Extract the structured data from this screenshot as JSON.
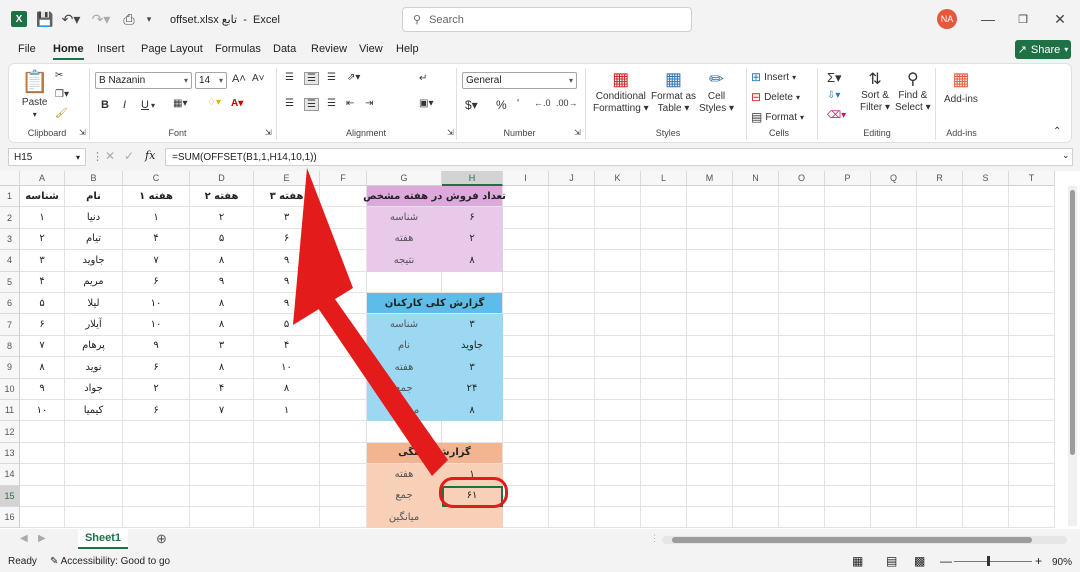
{
  "titlebar": {
    "filename": "offset.xlsx تابع",
    "app": "Excel",
    "search_placeholder": "Search",
    "avatar": "NA"
  },
  "menu": {
    "tabs": [
      "File",
      "Home",
      "Insert",
      "Page Layout",
      "Formulas",
      "Data",
      "Review",
      "View",
      "Help"
    ],
    "active": "Home",
    "share": "Share"
  },
  "ribbon": {
    "clipboard": {
      "paste": "Paste",
      "label": "Clipboard"
    },
    "font": {
      "name": "B Nazanin",
      "size": "14",
      "bold": "B",
      "italic": "I",
      "underline": "U",
      "label": "Font"
    },
    "alignment": {
      "label": "Alignment"
    },
    "number": {
      "format": "General",
      "label": "Number"
    },
    "styles": {
      "conditional": "Conditional",
      "formatting": "Formatting",
      "format_as": "Format as",
      "table": "Table",
      "cell": "Cell",
      "cell_styles": "Styles",
      "label": "Styles"
    },
    "cells": {
      "insert": "Insert",
      "delete": "Delete",
      "format": "Format",
      "label": "Cells"
    },
    "editing": {
      "sort": "Sort &",
      "filter": "Filter",
      "find": "Find &",
      "select": "Select",
      "label": "Editing"
    },
    "addins": {
      "name": "Add-ins",
      "label": "Add-ins"
    }
  },
  "formula_bar": {
    "cell": "H15",
    "fx": "fx",
    "formula": "=SUM(OFFSET(B1,1,H14,10,1))"
  },
  "grid": {
    "columns": [
      "A",
      "B",
      "C",
      "D",
      "E",
      "F",
      "G",
      "H",
      "I",
      "J",
      "K",
      "L",
      "M",
      "N",
      "O",
      "P",
      "Q",
      "R",
      "S",
      "T"
    ],
    "selected_col": "H",
    "rows": [
      "1",
      "2",
      "3",
      "4",
      "5",
      "6",
      "7",
      "8",
      "9",
      "10",
      "11",
      "12",
      "13",
      "14",
      "15",
      "16"
    ],
    "selected_row": "15",
    "table": [
      [
        "شناسه",
        "نام",
        "هفته ۱",
        "هفته ۲",
        "هفته ۳"
      ],
      [
        "۱",
        "دنیا",
        "۱",
        "۲",
        "۳"
      ],
      [
        "۲",
        "تیام",
        "۴",
        "۵",
        "۶"
      ],
      [
        "۳",
        "جاوید",
        "۷",
        "۸",
        "۹"
      ],
      [
        "۴",
        "مریم",
        "۶",
        "۹",
        "۹"
      ],
      [
        "۵",
        "لیلا",
        "۱۰",
        "۸",
        "۹"
      ],
      [
        "۶",
        "آیلار",
        "۱۰",
        "۸",
        "۵"
      ],
      [
        "۷",
        "پرهام",
        "۹",
        "۳",
        "۴"
      ],
      [
        "۸",
        "نوید",
        "۶",
        "۸",
        "۱۰"
      ],
      [
        "۹",
        "جواد",
        "۲",
        "۴",
        "۸"
      ],
      [
        "۱۰",
        "کیمیا",
        "۶",
        "۷",
        "۱"
      ]
    ],
    "box1": {
      "title": "تعداد فروش در هفته مشخص",
      "rows": [
        [
          "شناسه",
          "۶"
        ],
        [
          "هفته",
          "۲"
        ],
        [
          "نتیجه",
          "۸"
        ]
      ],
      "color": "#e9c9ea",
      "title_color": "#dda9dd"
    },
    "box2": {
      "title": "گزارش کلی کارکنان",
      "rows": [
        [
          "شناسه",
          "۳"
        ],
        [
          "نام",
          "جاوید"
        ],
        [
          "هفته",
          "۳"
        ],
        [
          "جمع",
          "۲۴"
        ],
        [
          "میانگین",
          "۸"
        ]
      ],
      "color": "#9dd8f3",
      "title_color": "#5bbde8"
    },
    "box3": {
      "title": "گزارش هفتگی",
      "rows": [
        [
          "هفته",
          "۱"
        ],
        [
          "جمع",
          "۶۱"
        ],
        [
          "میانگین",
          ""
        ]
      ],
      "color": "#f8d0b8",
      "title_color": "#f2b58f"
    }
  },
  "sheets": {
    "active": "Sheet1"
  },
  "status": {
    "ready": "Ready",
    "accessibility": "Accessibility: Good to go",
    "zoom": "90%"
  },
  "colors": {
    "accent": "#1e7145",
    "arrow": "#e31b1b"
  }
}
